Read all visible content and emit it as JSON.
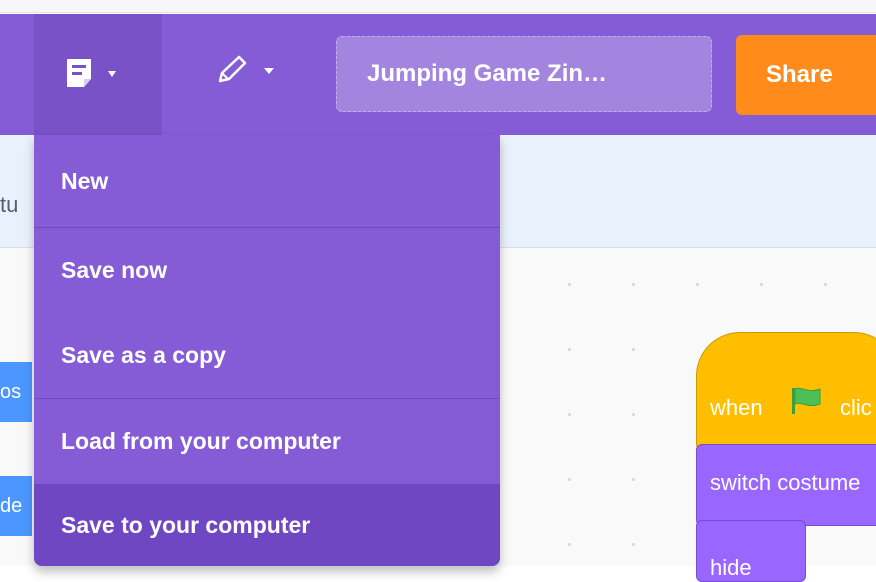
{
  "menubar": {
    "file_menu_icon": "file-icon",
    "edit_menu_icon": "pencil-icon",
    "dropdown_caret_icon": "caret-down-icon",
    "project_title": "Jumping Game Zin…",
    "share_label": "Share",
    "colors": {
      "bar": "#855cd6",
      "active": "#7a52c7",
      "share": "#ff8c1a"
    }
  },
  "file_menu": {
    "items": [
      {
        "label": "New"
      },
      {
        "label": "Save now"
      },
      {
        "label": "Save as a copy"
      },
      {
        "label": "Load from your computer"
      },
      {
        "label": "Save to your computer",
        "highlighted": true
      }
    ]
  },
  "editor": {
    "tab_fragment": "tu",
    "palette_block_1": "os",
    "palette_block_2": "de",
    "script": {
      "hat_label": "when",
      "hat_flag_icon": "green-flag-icon",
      "hat_suffix": "clic",
      "block_1": "switch costume",
      "block_2": "hide"
    }
  }
}
